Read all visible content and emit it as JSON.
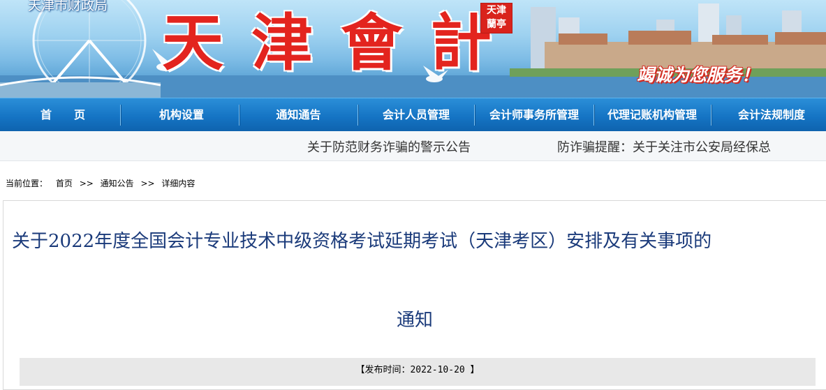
{
  "header": {
    "bureau_label": "天津市财政局",
    "title": "天津會計",
    "seal_text": "天津 蘭亭",
    "slogan": "竭诚为您服务！"
  },
  "nav": {
    "items": [
      {
        "label": "首　　页"
      },
      {
        "label": "机构设置"
      },
      {
        "label": "通知通告"
      },
      {
        "label": "会计人员管理"
      },
      {
        "label": "会计师事务所管理"
      },
      {
        "label": "代理记账机构管理"
      },
      {
        "label": "会计法规制度"
      }
    ]
  },
  "marquee": {
    "items": [
      {
        "label": "关于防范财务诈骗的警示公告"
      },
      {
        "label": "防诈骗提醒：关于关注市公安局经保总"
      }
    ]
  },
  "breadcrumb": {
    "prefix": "当前位置：",
    "items": [
      "首页",
      "通知公告",
      "详细内容"
    ],
    "separator": ">>"
  },
  "article": {
    "title_line1": "关于2022年度全国会计专业技术中级资格考试延期考试（天津考区）安排及有关事项的",
    "title_line2": "通知",
    "publish_label": "【发布时间：2022-10-20 】"
  },
  "colors": {
    "nav_bg": "#1574c4",
    "title_red": "#e3241e",
    "article_title": "#1a3a7a"
  }
}
